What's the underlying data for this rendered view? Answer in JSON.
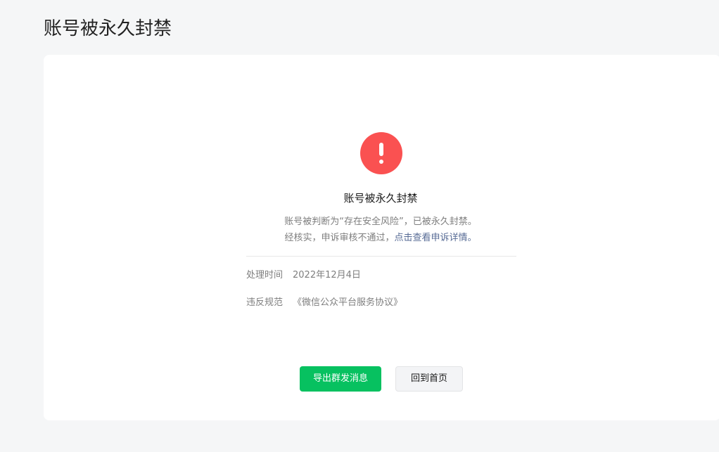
{
  "page": {
    "title": "账号被永久封禁"
  },
  "status": {
    "icon": "exclamation-circle-icon",
    "icon_color": "#fa5151",
    "title": "账号被永久封禁",
    "description_line1": "账号被判断为“存在安全风险”，已被永久封禁。",
    "description_line2_prefix": "经核实，申诉审核不通过，",
    "description_line2_link": "点击查看申诉详情。"
  },
  "info": {
    "time_label": "处理时间",
    "time_value": "2022年12月4日",
    "rule_label": "违反规范",
    "rule_value": "《微信公众平台服务协议》"
  },
  "actions": {
    "export_label": "导出群发消息",
    "home_label": "回到首页"
  },
  "colors": {
    "primary": "#07c160",
    "link": "#576b95",
    "danger": "#fa5151"
  }
}
